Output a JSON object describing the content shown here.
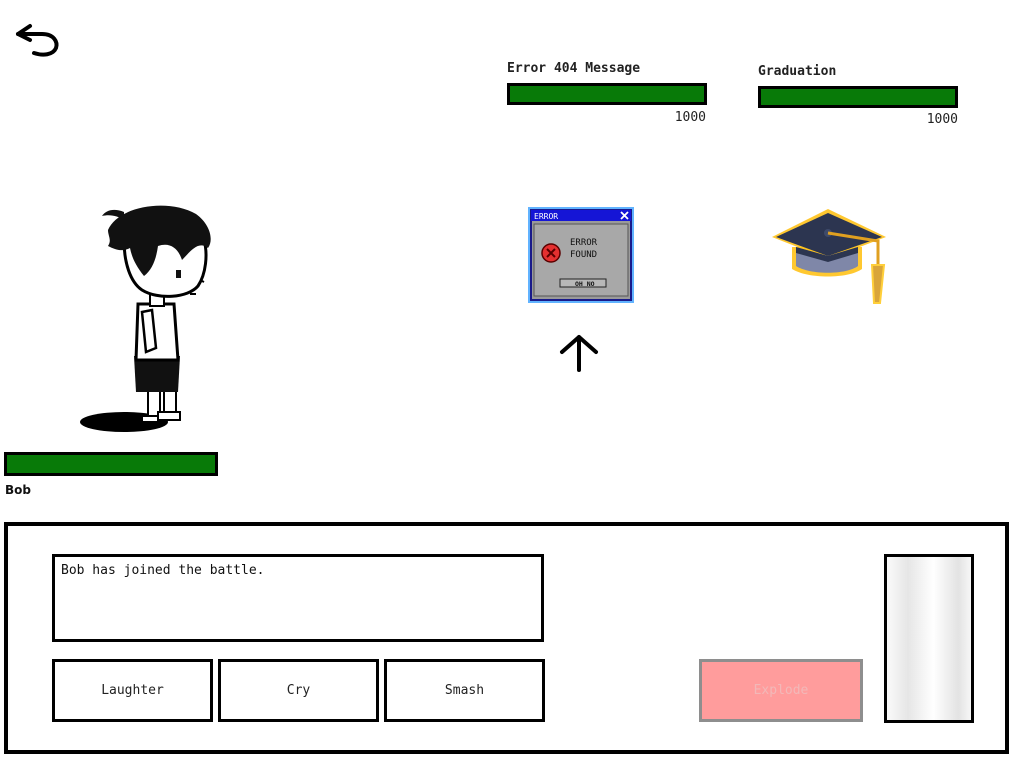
{
  "icons": {
    "back": "undo-arrow-icon",
    "target": "up-arrow-icon",
    "error_close": "close-x-icon",
    "error_symbol": "error-circle-icon"
  },
  "colors": {
    "hp_fill": "#087a08",
    "explode_bg": "#ff9c9c",
    "error_window_glow": "#1e90ff",
    "cap_glow": "#ffb000"
  },
  "enemies": [
    {
      "name": "Error 404 Message",
      "hp": "1000",
      "hp_fraction": 1.0,
      "sprite": {
        "title": "ERROR",
        "line1": "ERROR",
        "line2": "FOUND",
        "button": "OH NO"
      }
    },
    {
      "name": "Graduation",
      "hp": "1000",
      "hp_fraction": 1.0,
      "sprite": "graduation-cap"
    }
  ],
  "player": {
    "name": "Bob",
    "hp_fraction": 1.0
  },
  "battle_log": "Bob has joined the battle.",
  "commands": [
    "Laughter",
    "Cry",
    "Smash"
  ],
  "special_command": "Explode"
}
